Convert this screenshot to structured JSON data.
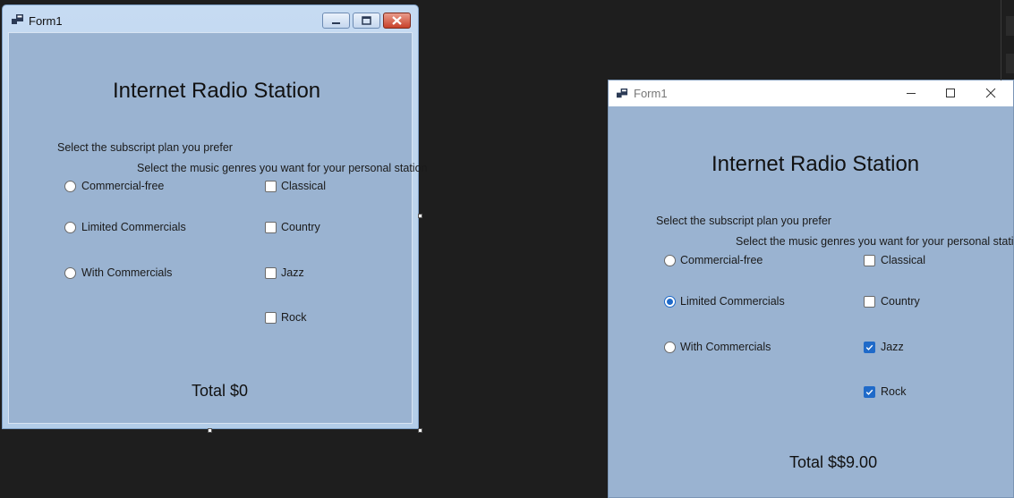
{
  "designer": {
    "window_title": "Form1",
    "heading": "Internet Radio Station",
    "plan_prompt": "Select the subscript plan you prefer",
    "genre_prompt": "Select the music genres you want for your personal station",
    "plans": [
      {
        "label": "Commercial-free",
        "checked": false
      },
      {
        "label": "Limited Commercials",
        "checked": false
      },
      {
        "label": "With Commercials",
        "checked": false
      }
    ],
    "genres": [
      {
        "label": "Classical",
        "checked": false
      },
      {
        "label": "Country",
        "checked": false
      },
      {
        "label": "Jazz",
        "checked": false
      },
      {
        "label": "Rock",
        "checked": false
      }
    ],
    "total": "Total $0"
  },
  "running": {
    "window_title": "Form1",
    "heading": "Internet Radio Station",
    "plan_prompt": "Select the subscript plan you prefer",
    "genre_prompt": "Select the music genres you want for your personal station",
    "plans": [
      {
        "label": "Commercial-free",
        "checked": false
      },
      {
        "label": "Limited Commercials",
        "checked": true
      },
      {
        "label": "With Commercials",
        "checked": false
      }
    ],
    "genres": [
      {
        "label": "Classical",
        "checked": false
      },
      {
        "label": "Country",
        "checked": false
      },
      {
        "label": "Jazz",
        "checked": true
      },
      {
        "label": "Rock",
        "checked": true
      }
    ],
    "total": "Total $$9.00"
  },
  "colors": {
    "form_background": "#9ab3d1",
    "accent": "#1f6ac9",
    "desktop": "#1e1e1e"
  }
}
